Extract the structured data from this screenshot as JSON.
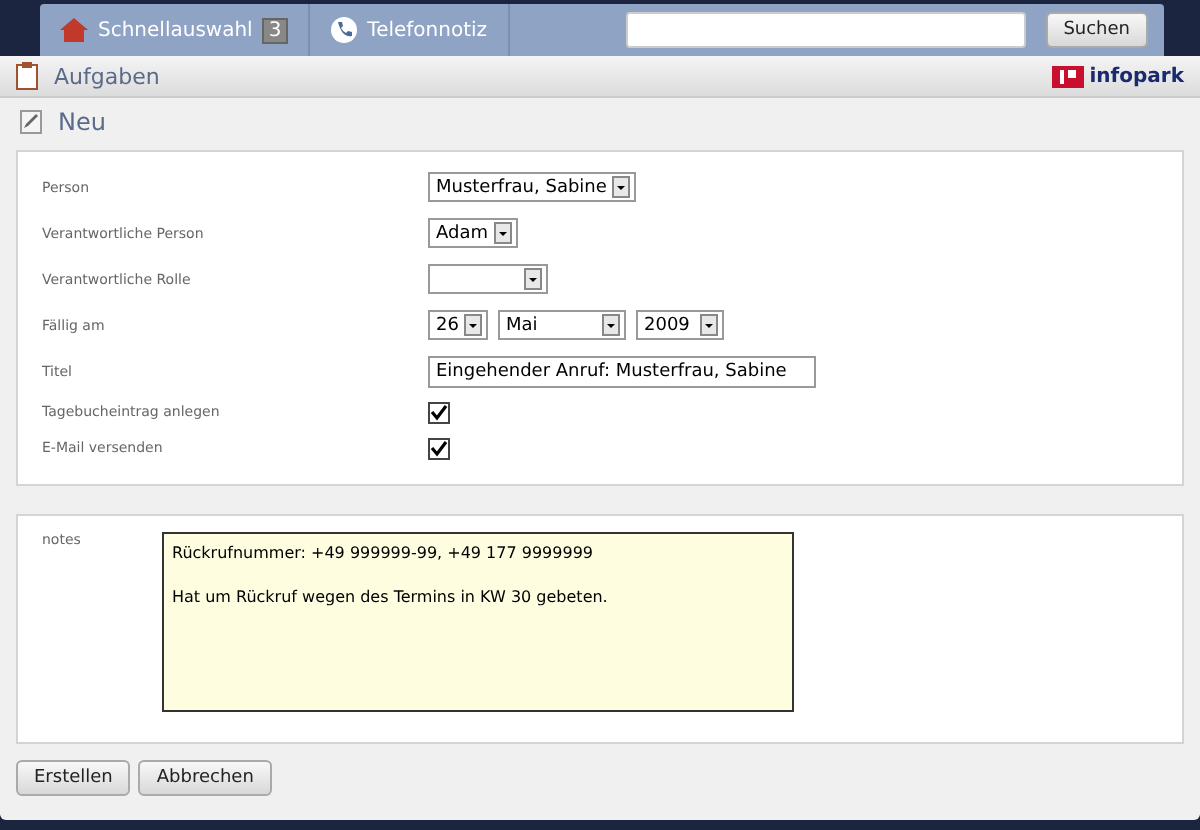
{
  "topbar": {
    "quick_select": {
      "label": "Schnellauswahl",
      "count": "3"
    },
    "phone_note": {
      "label": "Telefonnotiz"
    },
    "search": {
      "button": "Suchen"
    }
  },
  "panel": {
    "title": "Aufgaben",
    "logo": "infopark",
    "subtitle": "Neu"
  },
  "fields": [
    {
      "label": "Person",
      "kind": "select",
      "value": "Musterfrau, Sabine"
    },
    {
      "label": "Verantwortliche Person",
      "kind": "select",
      "value": "Adam"
    },
    {
      "label": "Verantwortliche Rolle",
      "kind": "select"
    },
    {
      "label": "Fällig am",
      "kind": "date",
      "parts": [
        "26",
        "Mai",
        "2009"
      ]
    },
    {
      "label": "Titel",
      "kind": "text",
      "value": "Eingehender Anruf: Musterfrau, Sabine"
    },
    {
      "label": "Tagebucheintrag anlegen",
      "kind": "checkbox",
      "checked": true
    },
    {
      "label": "E-Mail versenden",
      "kind": "checkbox",
      "checked": true
    }
  ],
  "notes": {
    "label": "notes",
    "paragraphs": [
      "Rückrufnummer: +49 999999-99, +49 177 9999999",
      "Hat um Rückruf wegen des Termins in KW 30 gebeten."
    ]
  },
  "buttons": [
    "Erstellen",
    "Abbrechen"
  ]
}
